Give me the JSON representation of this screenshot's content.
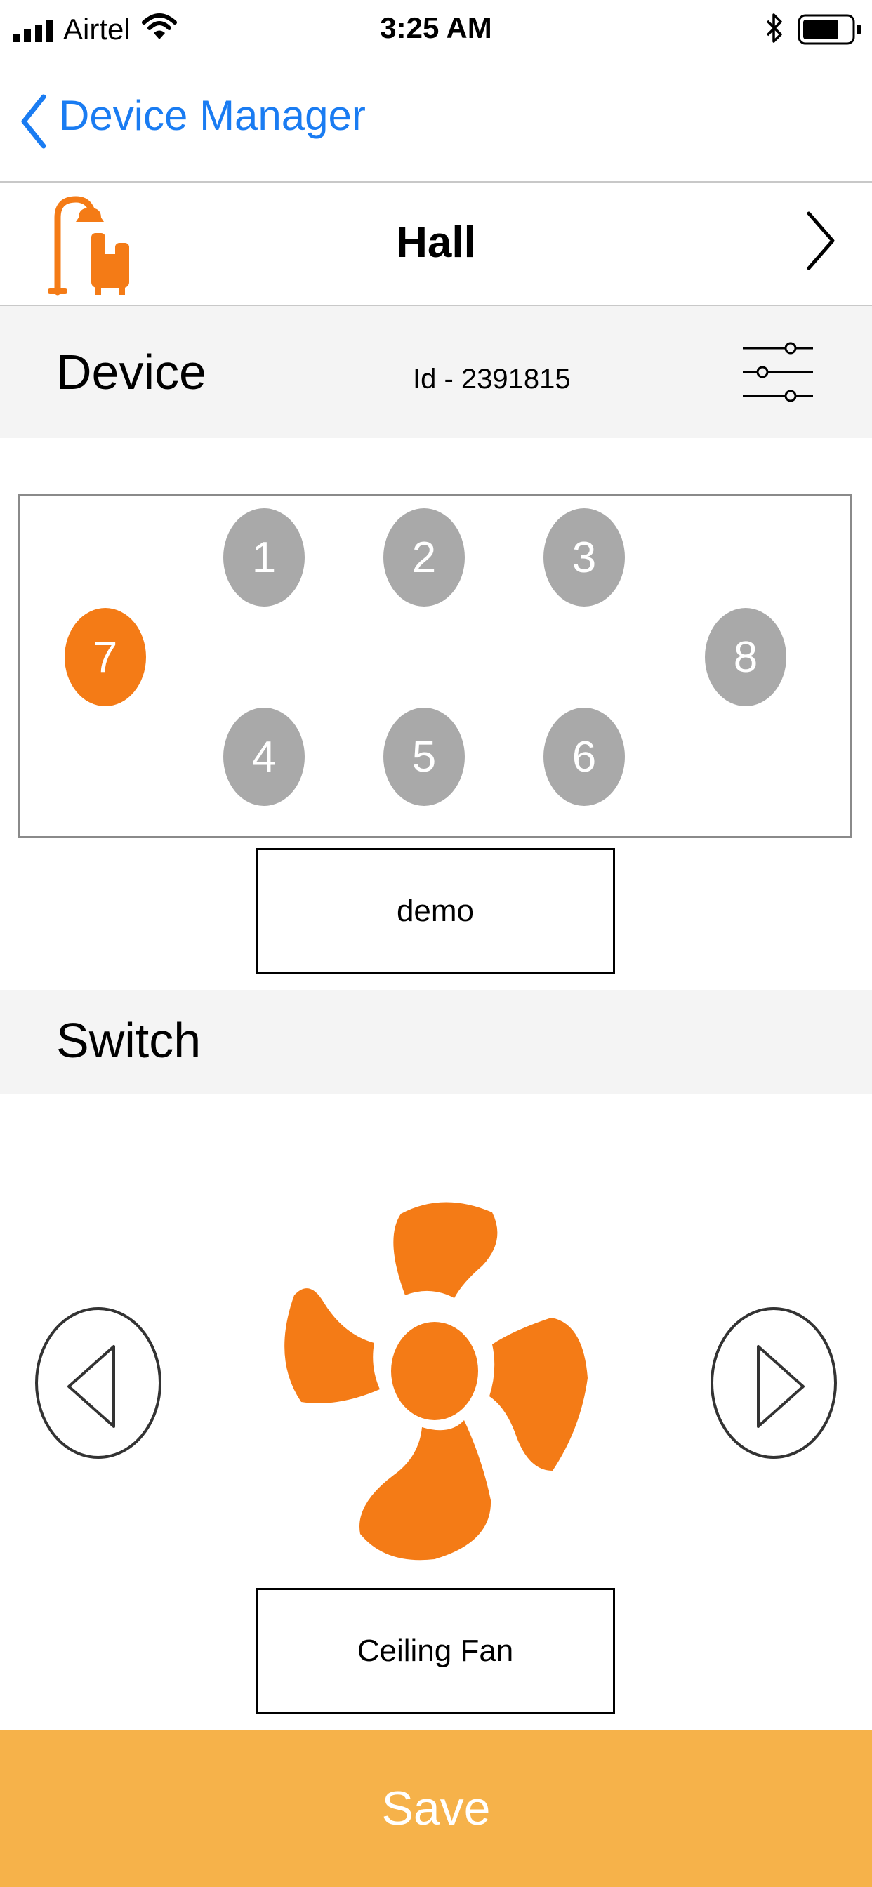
{
  "status_bar": {
    "carrier": "Airtel",
    "time": "3:25 AM"
  },
  "nav": {
    "back_title": "Device Manager"
  },
  "room": {
    "name": "Hall",
    "icon": "floor-lamp-armchair-icon"
  },
  "device_section": {
    "title": "Device",
    "id_text": "Id - 2391815"
  },
  "device_nodes": [
    {
      "label": "1",
      "active": false
    },
    {
      "label": "2",
      "active": false
    },
    {
      "label": "3",
      "active": false
    },
    {
      "label": "4",
      "active": false
    },
    {
      "label": "5",
      "active": false
    },
    {
      "label": "6",
      "active": false
    },
    {
      "label": "7",
      "active": true
    },
    {
      "label": "8",
      "active": false
    }
  ],
  "device_name": "demo",
  "switch_section": {
    "title": "Switch",
    "appliance": "Ceiling Fan",
    "icon": "fan-icon"
  },
  "save_label": "Save",
  "colors": {
    "accent": "#f47b16",
    "save": "#f6b24a",
    "link": "#1a7cf2",
    "inactive_node": "#a9a9a9"
  }
}
